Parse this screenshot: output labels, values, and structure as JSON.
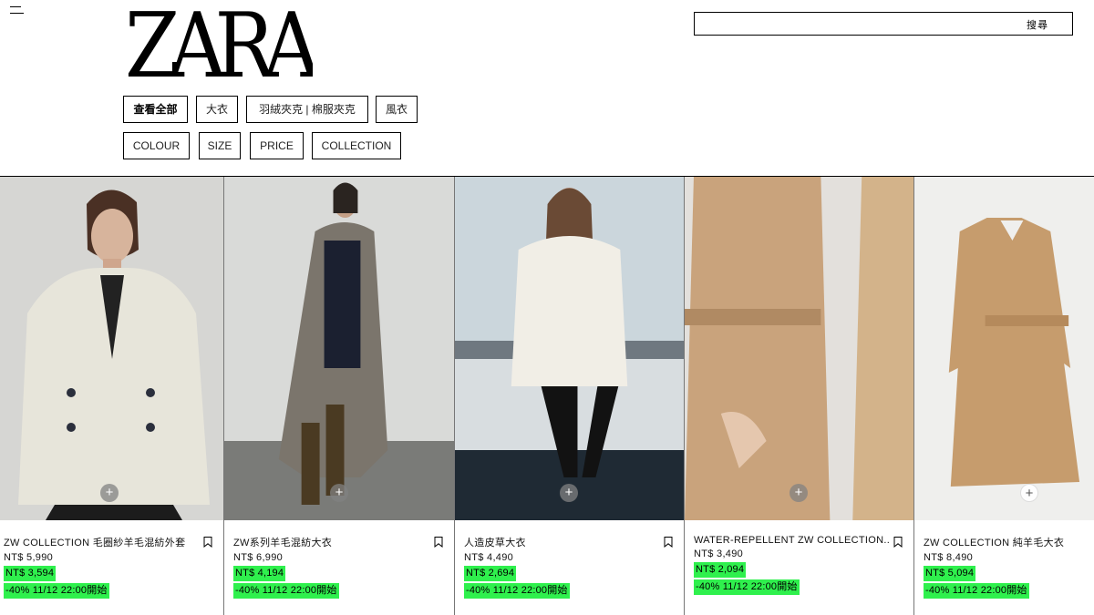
{
  "brand": "ZARA",
  "search": {
    "label": "搜尋"
  },
  "categories": [
    {
      "label": "查看全部",
      "active": true
    },
    {
      "label": "大衣",
      "active": false
    },
    {
      "label": "羽絨夾克 | 棉服夾克",
      "active": false
    },
    {
      "label": "風衣",
      "active": false
    }
  ],
  "filters": [
    {
      "label": "COLOUR"
    },
    {
      "label": "SIZE"
    },
    {
      "label": "PRICE"
    },
    {
      "label": "COLLECTION"
    }
  ],
  "colors": {
    "sale_highlight": "#2ff04d",
    "text": "#000000",
    "background": "#ffffff"
  },
  "products": [
    {
      "name": "ZW COLLECTION 毛圈紗羊毛混紡外套",
      "original_price": "NT$ 5,990",
      "sale_price": "NT$ 3,594",
      "discount": "-40% 11/12 22:00開始"
    },
    {
      "name": "ZW系列羊毛混紡大衣",
      "original_price": "NT$ 6,990",
      "sale_price": "NT$ 4,194",
      "discount": "-40% 11/12 22:00開始"
    },
    {
      "name": "人造皮草大衣",
      "original_price": "NT$ 4,490",
      "sale_price": "NT$ 2,694",
      "discount": "-40% 11/12 22:00開始"
    },
    {
      "name": "WATER-REPELLENT ZW COLLECTION...",
      "original_price": "NT$ 3,490",
      "sale_price": "NT$ 2,094",
      "discount": "-40% 11/12 22:00開始"
    },
    {
      "name": "ZW COLLECTION 純羊毛大衣",
      "original_price": "NT$ 8,490",
      "sale_price": "NT$ 5,094",
      "discount": "-40% 11/12 22:00開始"
    }
  ],
  "icons": {
    "menu": "menu-icon",
    "bookmark": "bookmark-icon",
    "quick_add": "plus-icon"
  }
}
